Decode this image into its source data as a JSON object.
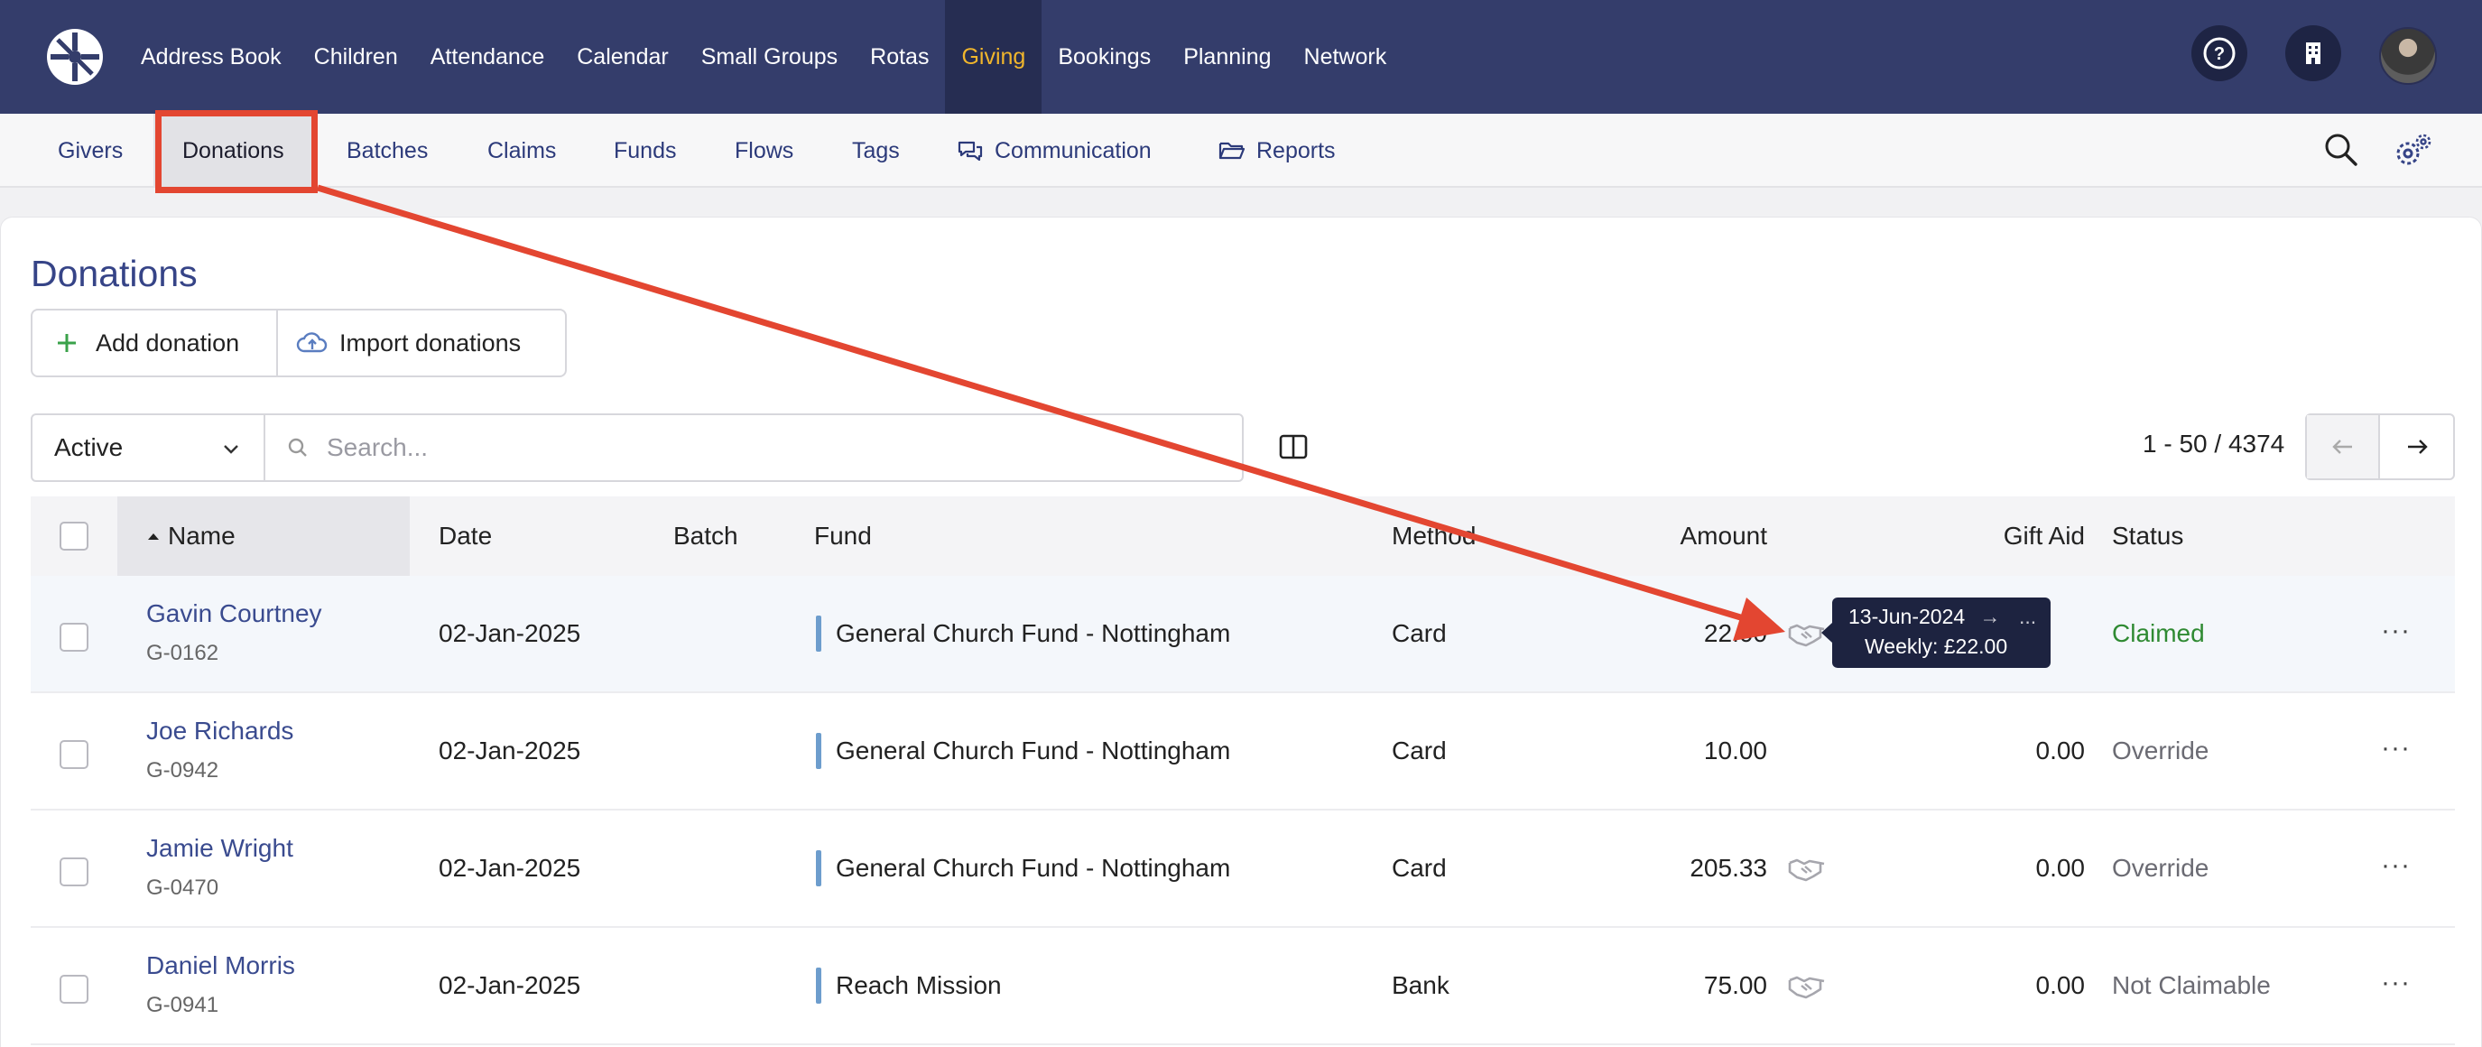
{
  "topnav": {
    "items": [
      "Address Book",
      "Children",
      "Attendance",
      "Calendar",
      "Small Groups",
      "Rotas",
      "Giving",
      "Bookings",
      "Planning",
      "Network"
    ],
    "active": "Giving",
    "icons": [
      "help-icon",
      "building-icon",
      "avatar"
    ]
  },
  "subnav": {
    "items": [
      "Givers",
      "Donations",
      "Batches",
      "Claims",
      "Funds",
      "Flows",
      "Tags",
      "Communication",
      "Reports"
    ],
    "active": "Donations"
  },
  "page": {
    "title": "Donations",
    "add_label": "Add donation",
    "import_label": "Import donations"
  },
  "filter": {
    "status_value": "Active",
    "search_placeholder": "Search..."
  },
  "pager": {
    "range": "1 - 50",
    "total": "/ 4374"
  },
  "table": {
    "columns": [
      "Name",
      "Date",
      "Batch",
      "Fund",
      "Method",
      "Amount",
      "Gift Aid",
      "Status"
    ],
    "rows": [
      {
        "name": "Gavin Courtney",
        "code": "G-0162",
        "date": "02-Jan-2025",
        "batch": "",
        "fund": "General Church Fund - Nottingham",
        "method": "Card",
        "amount": "22.00",
        "gift_aid": "",
        "status": "Claimed"
      },
      {
        "name": "Joe Richards",
        "code": "G-0942",
        "date": "02-Jan-2025",
        "batch": "",
        "fund": "General Church Fund - Nottingham",
        "method": "Card",
        "amount": "10.00",
        "gift_aid": "0.00",
        "status": "Override"
      },
      {
        "name": "Jamie Wright",
        "code": "G-0470",
        "date": "02-Jan-2025",
        "batch": "",
        "fund": "General Church Fund - Nottingham",
        "method": "Card",
        "amount": "205.33",
        "gift_aid": "0.00",
        "status": "Override"
      },
      {
        "name": "Daniel Morris",
        "code": "G-0941",
        "date": "02-Jan-2025",
        "batch": "",
        "fund": "Reach Mission",
        "method": "Bank",
        "amount": "75.00",
        "gift_aid": "0.00",
        "status": "Not Claimable"
      }
    ]
  },
  "tooltip": {
    "line1": "13-Jun-2024",
    "arrow": "→",
    "ellipsis": "...",
    "line2": "Weekly: £22.00"
  },
  "colors": {
    "nav_bg": "#343d6b",
    "active_nav": "#f1b62c",
    "annotation": "#e34631",
    "claimed": "#2f8a32"
  }
}
